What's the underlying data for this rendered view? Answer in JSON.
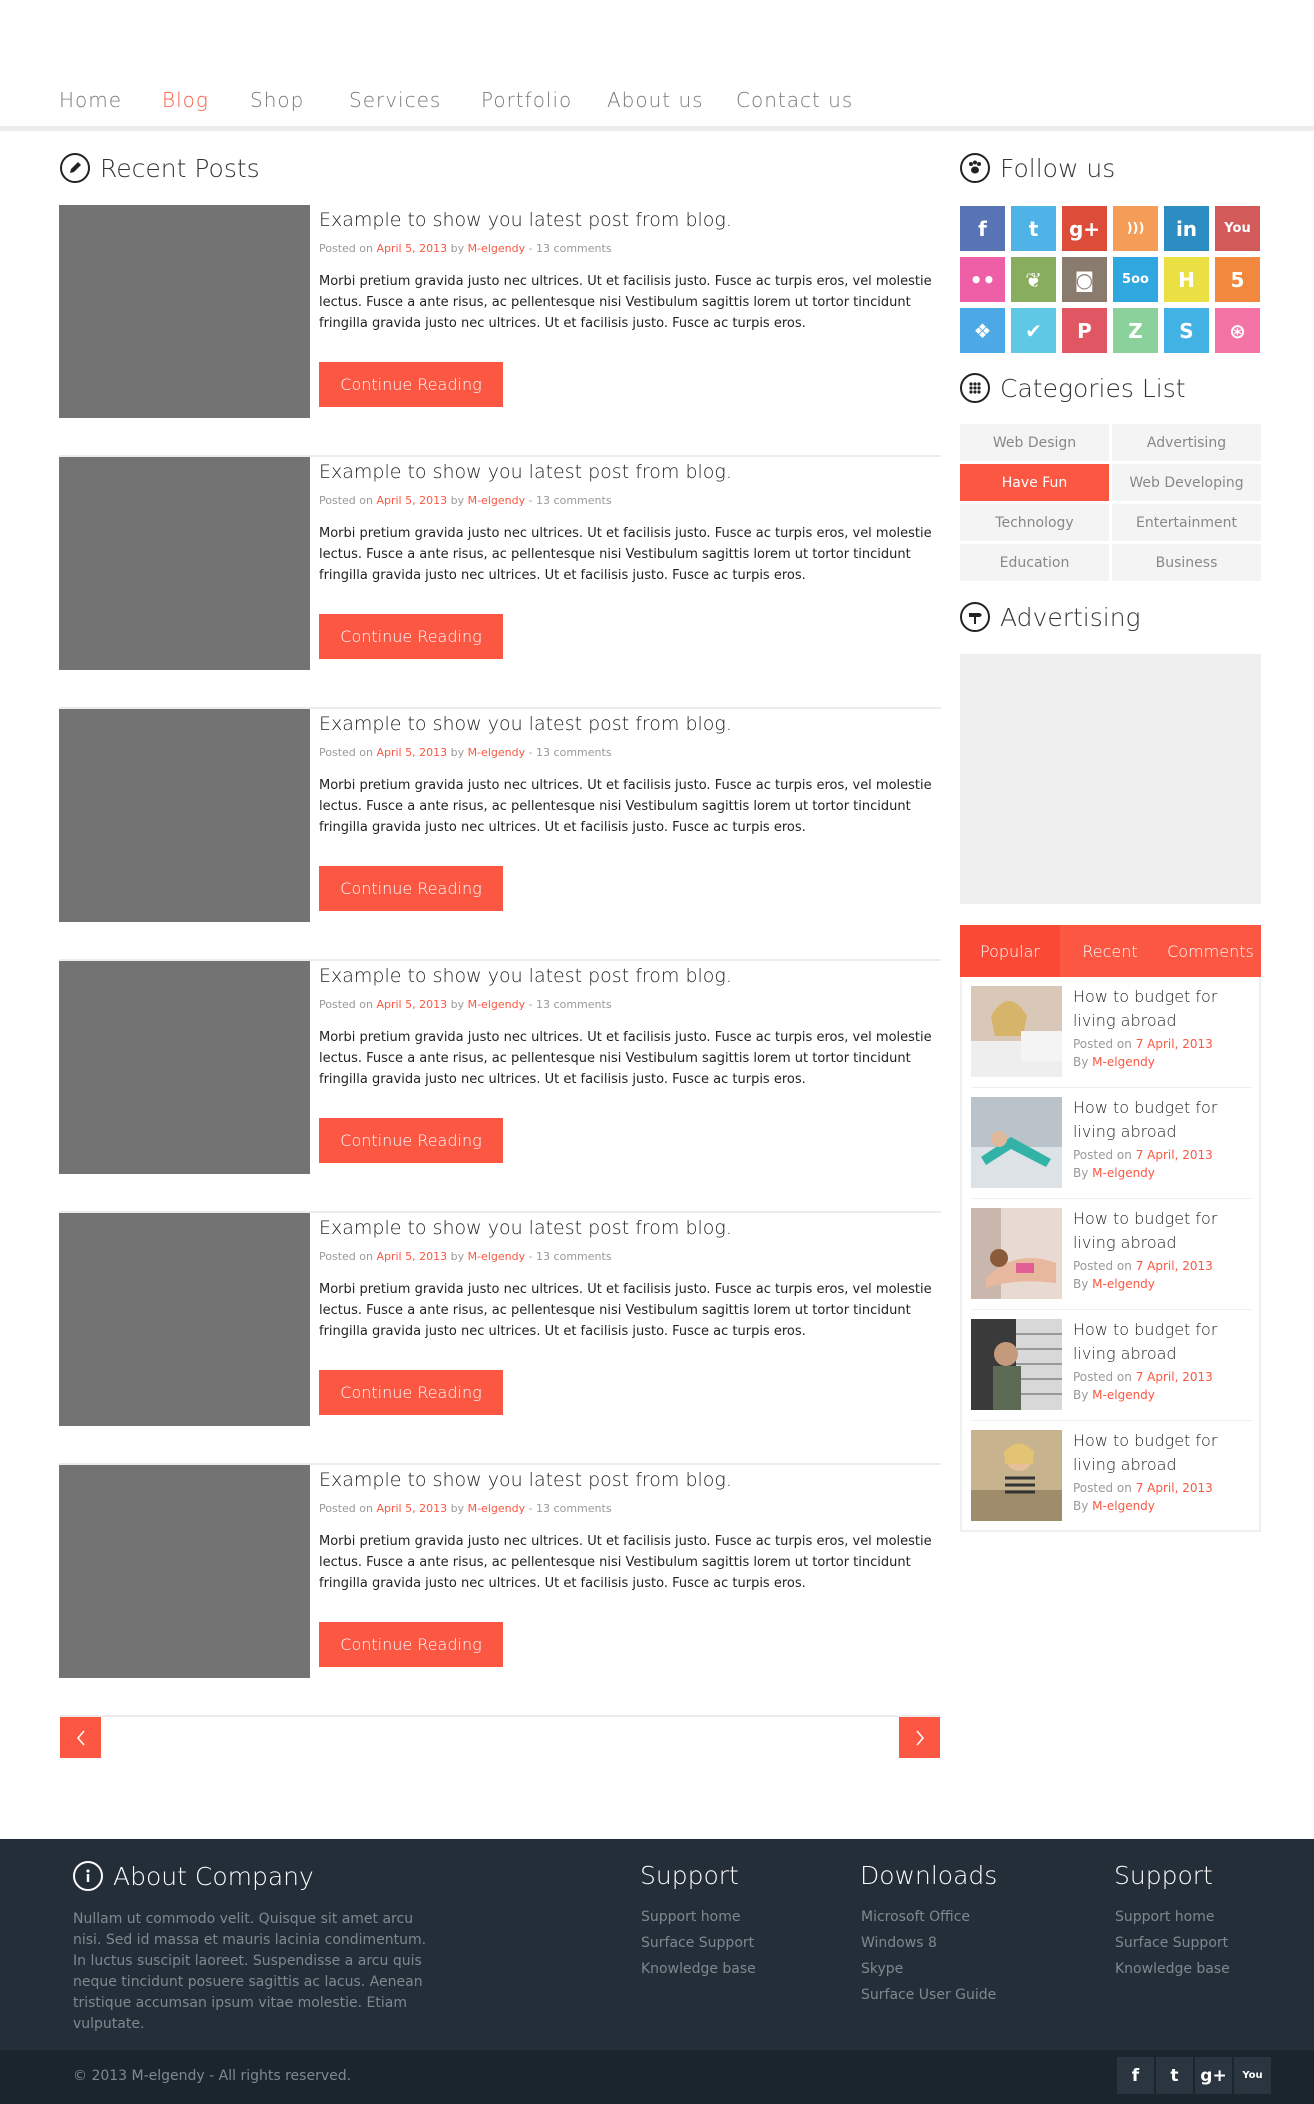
{
  "nav": {
    "items": [
      {
        "label": "Home"
      },
      {
        "label": "Blog"
      },
      {
        "label": "Shop"
      },
      {
        "label": "Services"
      },
      {
        "label": "Portfolio"
      },
      {
        "label": "About us"
      },
      {
        "label": "Contact us"
      }
    ],
    "active": "Blog"
  },
  "main": {
    "heading": "Recent Posts",
    "posts": [
      {
        "title": "Example to show you latest post from blog.",
        "posted_on": "Posted on",
        "date": "April 5, 2013",
        "by": "by",
        "author": "M-elgendy",
        "comments": "- 13 comments",
        "excerpt": "Morbi pretium gravida justo nec ultrices. Ut et facilisis justo. Fusce ac turpis eros, vel molestie lectus. Fusce a ante risus, ac pellentesque nisi Vestibulum sagittis lorem ut tortor tincidunt fringilla gravida justo nec ultrices. Ut et facilisis justo. Fusce ac turpis eros.",
        "button": "Continue Reading"
      },
      {
        "title": "Example to show you latest post from blog.",
        "posted_on": "Posted on",
        "date": "April 5, 2013",
        "by": "by",
        "author": "M-elgendy",
        "comments": "- 13 comments",
        "excerpt": "Morbi pretium gravida justo nec ultrices. Ut et facilisis justo. Fusce ac turpis eros, vel molestie lectus. Fusce a ante risus, ac pellentesque nisi Vestibulum sagittis lorem ut tortor tincidunt fringilla gravida justo nec ultrices. Ut et facilisis justo. Fusce ac turpis eros.",
        "button": "Continue Reading"
      },
      {
        "title": "Example to show you latest post from blog.",
        "posted_on": "Posted on",
        "date": "April 5, 2013",
        "by": "by",
        "author": "M-elgendy",
        "comments": "- 13 comments",
        "excerpt": "Morbi pretium gravida justo nec ultrices. Ut et facilisis justo. Fusce ac turpis eros, vel molestie lectus. Fusce a ante risus, ac pellentesque nisi Vestibulum sagittis lorem ut tortor tincidunt fringilla gravida justo nec ultrices. Ut et facilisis justo. Fusce ac turpis eros.",
        "button": "Continue Reading"
      },
      {
        "title": "Example to show you latest post from blog.",
        "posted_on": "Posted on",
        "date": "April 5, 2013",
        "by": "by",
        "author": "M-elgendy",
        "comments": "- 13 comments",
        "excerpt": "Morbi pretium gravida justo nec ultrices. Ut et facilisis justo. Fusce ac turpis eros, vel molestie lectus. Fusce a ante risus, ac pellentesque nisi Vestibulum sagittis lorem ut tortor tincidunt fringilla gravida justo nec ultrices. Ut et facilisis justo. Fusce ac turpis eros.",
        "button": "Continue Reading"
      },
      {
        "title": "Example to show you latest post from blog.",
        "posted_on": "Posted on",
        "date": "April 5, 2013",
        "by": "by",
        "author": "M-elgendy",
        "comments": "- 13 comments",
        "excerpt": "Morbi pretium gravida justo nec ultrices. Ut et facilisis justo. Fusce ac turpis eros, vel molestie lectus. Fusce a ante risus, ac pellentesque nisi Vestibulum sagittis lorem ut tortor tincidunt fringilla gravida justo nec ultrices. Ut et facilisis justo. Fusce ac turpis eros.",
        "button": "Continue Reading"
      },
      {
        "title": "Example to show you latest post from blog.",
        "posted_on": "Posted on",
        "date": "April 5, 2013",
        "by": "by",
        "author": "M-elgendy",
        "comments": "- 13 comments",
        "excerpt": "Morbi pretium gravida justo nec ultrices. Ut et facilisis justo. Fusce ac turpis eros, vel molestie lectus. Fusce a ante risus, ac pellentesque nisi Vestibulum sagittis lorem ut tortor tincidunt fringilla gravida justo nec ultrices. Ut et facilisis justo. Fusce ac turpis eros.",
        "button": "Continue Reading"
      }
    ],
    "pager": {
      "prev_icon": "chevron-left-icon",
      "next_icon": "chevron-right-icon"
    }
  },
  "sidebar": {
    "follow_heading": "Follow us",
    "socials": [
      {
        "name": "facebook-icon",
        "glyph": "f",
        "color": "#5874b5"
      },
      {
        "name": "twitter-icon",
        "glyph": "t",
        "color": "#4fb3e8"
      },
      {
        "name": "google-plus-icon",
        "glyph": "g+",
        "color": "#dd4b39"
      },
      {
        "name": "rss-icon",
        "glyph": ")))",
        "color": "#f59d56"
      },
      {
        "name": "linkedin-icon",
        "glyph": "in",
        "color": "#2b8dc1"
      },
      {
        "name": "youtube-icon",
        "glyph": "You",
        "color": "#d25a58"
      },
      {
        "name": "flickr-icon",
        "glyph": "••",
        "color": "#ef5fa8"
      },
      {
        "name": "envato-icon",
        "glyph": "❦",
        "color": "#88ad5f"
      },
      {
        "name": "instagram-icon",
        "glyph": "◙",
        "color": "#8a7b6f"
      },
      {
        "name": "500px-icon",
        "glyph": "5oo",
        "color": "#31a7e0"
      },
      {
        "name": "hype-icon",
        "glyph": "H",
        "color": "#ebe043"
      },
      {
        "name": "html5-icon",
        "glyph": "5",
        "color": "#f2883d"
      },
      {
        "name": "dropbox-icon",
        "glyph": "❖",
        "color": "#4da9e6"
      },
      {
        "name": "check-icon",
        "glyph": "✔",
        "color": "#5fc8e5"
      },
      {
        "name": "pinterest-icon",
        "glyph": "P",
        "color": "#e05663"
      },
      {
        "name": "zerply-icon",
        "glyph": "Z",
        "color": "#8ad19b"
      },
      {
        "name": "skype-icon",
        "glyph": "S",
        "color": "#42b2e5"
      },
      {
        "name": "dribbble-icon",
        "glyph": "⊛",
        "color": "#f373a5"
      }
    ],
    "categories_heading": "Categories List",
    "categories": [
      {
        "label": "Web Design"
      },
      {
        "label": "Advertising"
      },
      {
        "label": "Have Fun"
      },
      {
        "label": "Web Developing"
      },
      {
        "label": "Technology"
      },
      {
        "label": "Entertainment"
      },
      {
        "label": "Education"
      },
      {
        "label": "Business"
      }
    ],
    "active_category": "Have Fun",
    "advertising_heading": "Advertising",
    "tabs": [
      {
        "label": "Popular"
      },
      {
        "label": "Recent"
      },
      {
        "label": "Comments"
      }
    ],
    "active_tab": "Popular",
    "popular": [
      {
        "title": "How to budget for living abroad",
        "posted_on": "Posted on",
        "date": "7 April, 2013",
        "by": "By",
        "author": "M-elgendy"
      },
      {
        "title": "How to budget for living abroad",
        "posted_on": "Posted on",
        "date": "7 April, 2013",
        "by": "By",
        "author": "M-elgendy"
      },
      {
        "title": "How to budget for living abroad",
        "posted_on": "Posted on",
        "date": "7 April, 2013",
        "by": "By",
        "author": "M-elgendy"
      },
      {
        "title": "How to budget for living abroad",
        "posted_on": "Posted on",
        "date": "7 April, 2013",
        "by": "By",
        "author": "M-elgendy"
      },
      {
        "title": "How to budget for living abroad",
        "posted_on": "Posted on",
        "date": "7 April, 2013",
        "by": "By",
        "author": "M-elgendy"
      }
    ]
  },
  "footer": {
    "about_heading": "About Company",
    "about_text": "Nullam ut commodo velit. Quisque sit amet arcu nisi. Sed id massa et mauris lacinia condimentum. In luctus suscipit laoreet. Suspendisse a arcu quis neque tincidunt posuere sagittis ac lacus. Aenean tristique accumsan ipsum vitae molestie. Etiam vulputate.",
    "col1": {
      "heading": "Support",
      "links": [
        "Support home",
        "Surface Support",
        "Knowledge base"
      ]
    },
    "col2": {
      "heading": "Downloads",
      "links": [
        "Microsoft Office",
        "Windows 8",
        "Skype",
        "Surface User Guide"
      ]
    },
    "col3": {
      "heading": "Support",
      "links": [
        "Support home",
        "Surface Support",
        "Knowledge base"
      ]
    },
    "copyright": "© 2013 M-elgendy - All rights reserved.",
    "socials": [
      {
        "name": "facebook-icon",
        "glyph": "f"
      },
      {
        "name": "twitter-icon",
        "glyph": "t"
      },
      {
        "name": "google-plus-icon",
        "glyph": "g+"
      },
      {
        "name": "youtube-icon",
        "glyph": "You"
      }
    ]
  },
  "colors": {
    "accent": "#fb5742",
    "footer_bg": "#232e38",
    "footer_bottom": "#1b252e",
    "thumb": "#737373"
  }
}
